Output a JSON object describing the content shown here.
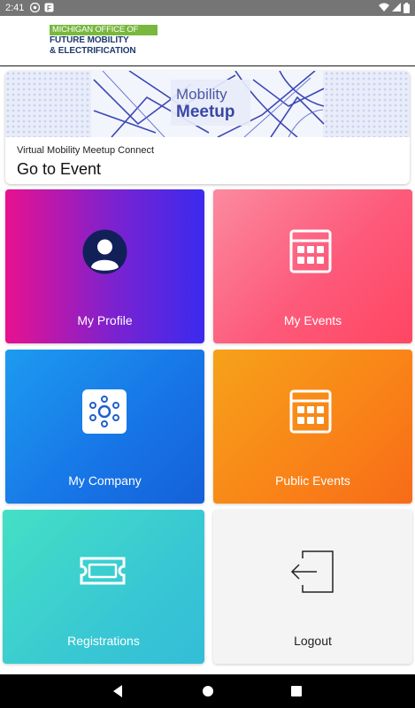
{
  "status_bar": {
    "time": "2:41"
  },
  "header": {
    "logo_line1": "MICHIGAN OFFICE OF",
    "logo_line2": "FUTURE MOBILITY",
    "logo_line3": "& ELECTRIFICATION"
  },
  "event_card": {
    "banner_line1": "Mobility",
    "banner_line2": "Meetup",
    "subtitle": "Virtual Mobility Meetup Connect",
    "cta": "Go to Event"
  },
  "tiles": [
    {
      "label": "My Profile",
      "icon": "avatar-icon"
    },
    {
      "label": "My Events",
      "icon": "calendar-icon"
    },
    {
      "label": "My Company",
      "icon": "company-icon"
    },
    {
      "label": "Public Events",
      "icon": "calendar-icon"
    },
    {
      "label": "Registrations",
      "icon": "ticket-icon"
    },
    {
      "label": "Logout",
      "icon": "logout-icon"
    }
  ],
  "colors": {
    "status_bar": "#757575",
    "logo_green": "#79b83e",
    "logo_navy": "#1d3a6e",
    "profile_gradient": [
      "#e8118f",
      "#3b2aee"
    ],
    "events_gradient": [
      "#fb8aa0",
      "#ff4663"
    ],
    "company_gradient": [
      "#1d9bf0",
      "#1560d9"
    ],
    "public_gradient": [
      "#f6a21a",
      "#f76b18"
    ],
    "registrations_gradient": [
      "#44e0c4",
      "#34bdd8"
    ],
    "logout_bg": "#f4f4f4"
  }
}
